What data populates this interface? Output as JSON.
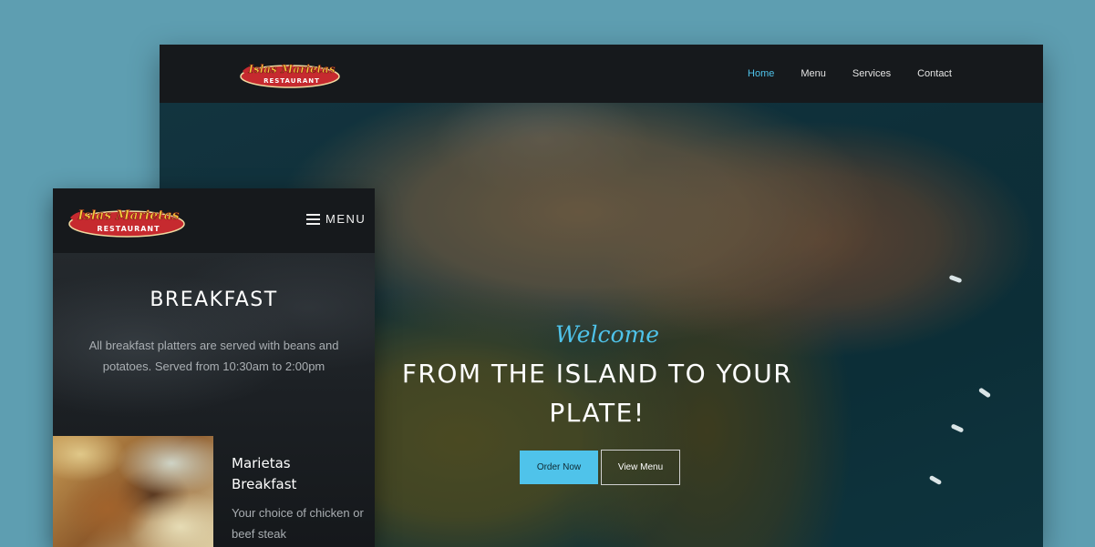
{
  "desktop": {
    "logo": {
      "name": "Islas Marietas",
      "tagline": "RESTAURANT",
      "icon": "restaurant-logo-icon"
    },
    "nav": [
      {
        "label": "Home",
        "active": true
      },
      {
        "label": "Menu",
        "active": false
      },
      {
        "label": "Services",
        "active": false
      },
      {
        "label": "Contact",
        "active": false
      }
    ],
    "hero": {
      "welcome": "Welcome",
      "headline": "FROM THE ISLAND TO YOUR PLATE!",
      "order_button": "Order Now",
      "menu_button": "View Menu"
    }
  },
  "mobile": {
    "logo": {
      "name": "Islas Marietas",
      "tagline": "RESTAURANT",
      "icon": "restaurant-logo-icon"
    },
    "menu_label": "MENU",
    "section": {
      "title": "BREAKFAST",
      "description": "All breakfast platters are served with beans and potatoes. Served from 10:30am to 2:00pm"
    },
    "item": {
      "title": "Marietas Breakfast",
      "description": "Your choice of chicken or beef steak"
    }
  },
  "colors": {
    "page_background": "#5e9eb1",
    "accent": "#4fc3ea",
    "nav_background": "#16191c",
    "logo_red": "#c62a2f",
    "logo_yellow": "#f5c93b"
  }
}
